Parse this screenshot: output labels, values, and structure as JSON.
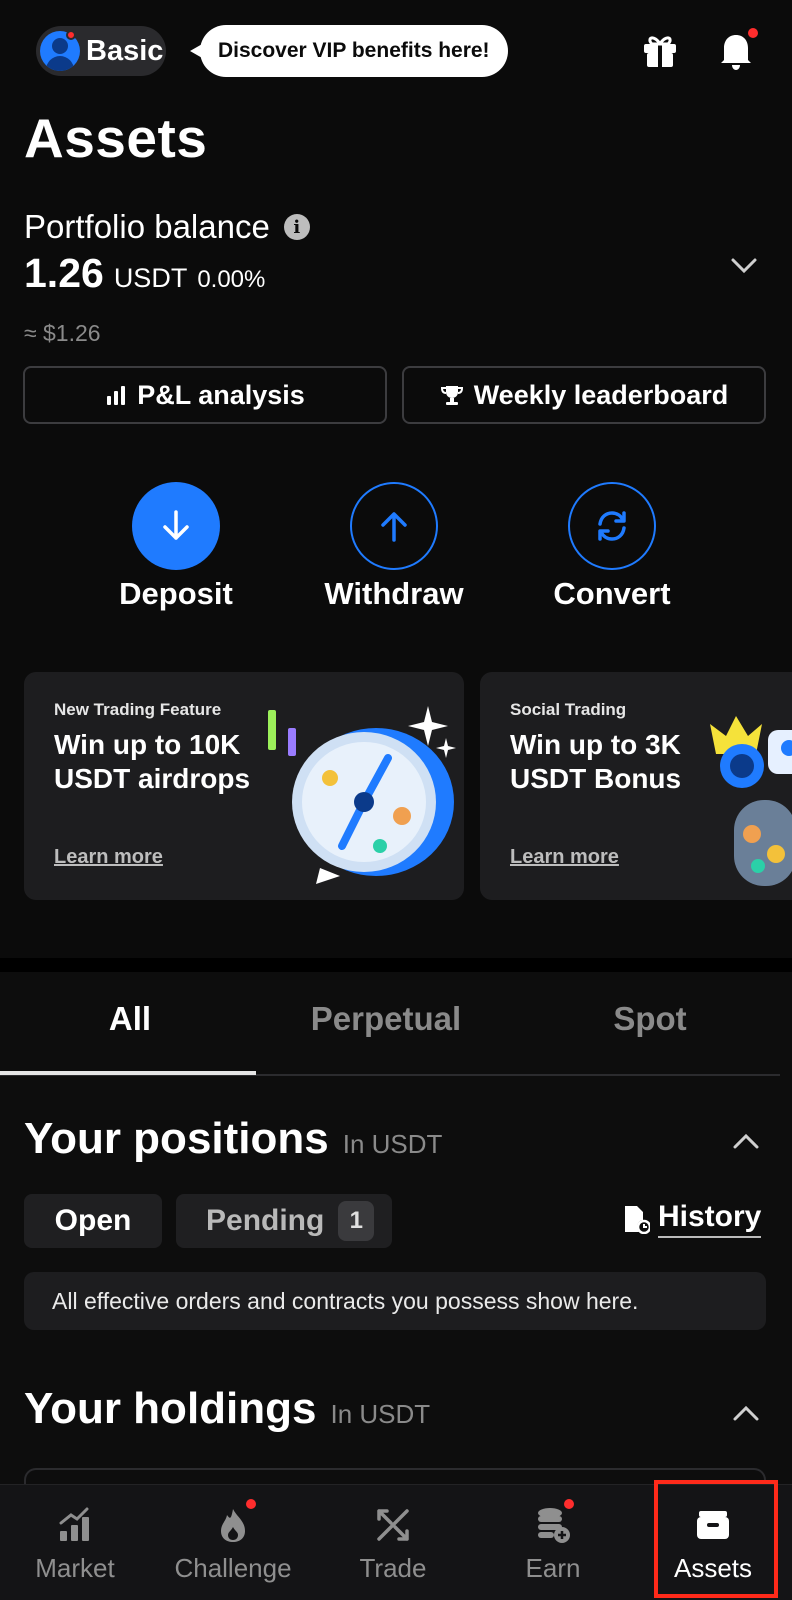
{
  "header": {
    "tier_label": "Basic",
    "vip_bubble": "Discover VIP benefits here!",
    "page_title": "Assets"
  },
  "portfolio": {
    "label": "Portfolio balance",
    "balance": "1.26",
    "unit": "USDT",
    "change": "0.00%",
    "usd_value": "≈ $1.26"
  },
  "quick_buttons": {
    "pl_analysis": "P&L analysis",
    "weekly_leaderboard": "Weekly leaderboard"
  },
  "actions": {
    "deposit": "Deposit",
    "withdraw": "Withdraw",
    "convert": "Convert"
  },
  "promos": [
    {
      "tag": "New Trading Feature",
      "headline": "Win up to 10K USDT airdrops",
      "link": "Learn more"
    },
    {
      "tag": "Social Trading",
      "headline": "Win up to 3K USDT Bonus",
      "link": "Learn more"
    }
  ],
  "tabs": [
    {
      "label": "All",
      "active": true
    },
    {
      "label": "Perpetual",
      "active": false
    },
    {
      "label": "Spot",
      "active": false
    }
  ],
  "positions": {
    "title": "Your positions",
    "unit": "In USDT",
    "open_label": "Open",
    "pending_label": "Pending",
    "pending_count": "1",
    "history_label": "History",
    "empty_message": "All effective orders and contracts you possess show here."
  },
  "holdings": {
    "title": "Your holdings",
    "unit": "In USDT"
  },
  "bottom_nav": [
    {
      "label": "Market",
      "icon": "market-chart-icon"
    },
    {
      "label": "Challenge",
      "icon": "flame-icon"
    },
    {
      "label": "Trade",
      "icon": "trade-arrows-icon"
    },
    {
      "label": "Earn",
      "icon": "coins-stack-icon"
    },
    {
      "label": "Assets",
      "icon": "wallet-icon"
    }
  ],
  "colors": {
    "background": "#0b0b0b",
    "accent": "#1f7bff",
    "alert_dot": "#ff2d2d",
    "highlight": "#ff2a1a"
  }
}
